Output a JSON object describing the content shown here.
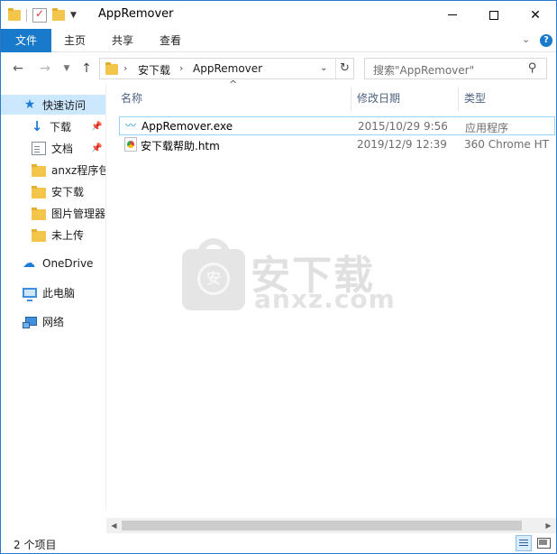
{
  "window": {
    "title": "AppRemover",
    "controls": {
      "minimize": "minimize",
      "maximize": "maximize",
      "close": "✕"
    }
  },
  "ribbon": {
    "file_tab": "文件",
    "tabs": [
      "主页",
      "共享",
      "查看"
    ],
    "help": "?"
  },
  "navigation": {
    "breadcrumb": [
      "安下载",
      "AppRemover"
    ],
    "search_placeholder": "搜索\"AppRemover\""
  },
  "sidebar": {
    "quick_access": "快速访问",
    "pinned": [
      {
        "label": "下载",
        "icon": "download-icon",
        "pinned": true
      },
      {
        "label": "文档",
        "icon": "document-icon",
        "pinned": true
      },
      {
        "label": "anxz程序包",
        "icon": "folder-icon",
        "pinned": false
      },
      {
        "label": "安下载",
        "icon": "folder-icon",
        "pinned": false
      },
      {
        "label": "图片管理器",
        "icon": "folder-icon",
        "pinned": false
      },
      {
        "label": "未上传",
        "icon": "folder-icon",
        "pinned": false
      }
    ],
    "onedrive": "OneDrive",
    "this_pc": "此电脑",
    "network": "网络"
  },
  "file_list": {
    "columns": {
      "name": "名称",
      "date": "修改日期",
      "type": "类型"
    },
    "sort_indicator": "^",
    "rows": [
      {
        "name": "AppRemover.exe",
        "date": "2015/10/29 9:56",
        "type": "应用程序",
        "icon": "exe-icon"
      },
      {
        "name": "安下载帮助.htm",
        "date": "2019/12/9 12:39",
        "type": "360 Chrome HT",
        "icon": "chrome-html-icon"
      }
    ]
  },
  "watermark": {
    "brand": "安下载",
    "url": "anxz.com"
  },
  "status": {
    "item_count": "2 个项目"
  },
  "colors": {
    "accent": "#1979ca",
    "selection": "#cce8ff",
    "header_text": "#4d6382"
  }
}
